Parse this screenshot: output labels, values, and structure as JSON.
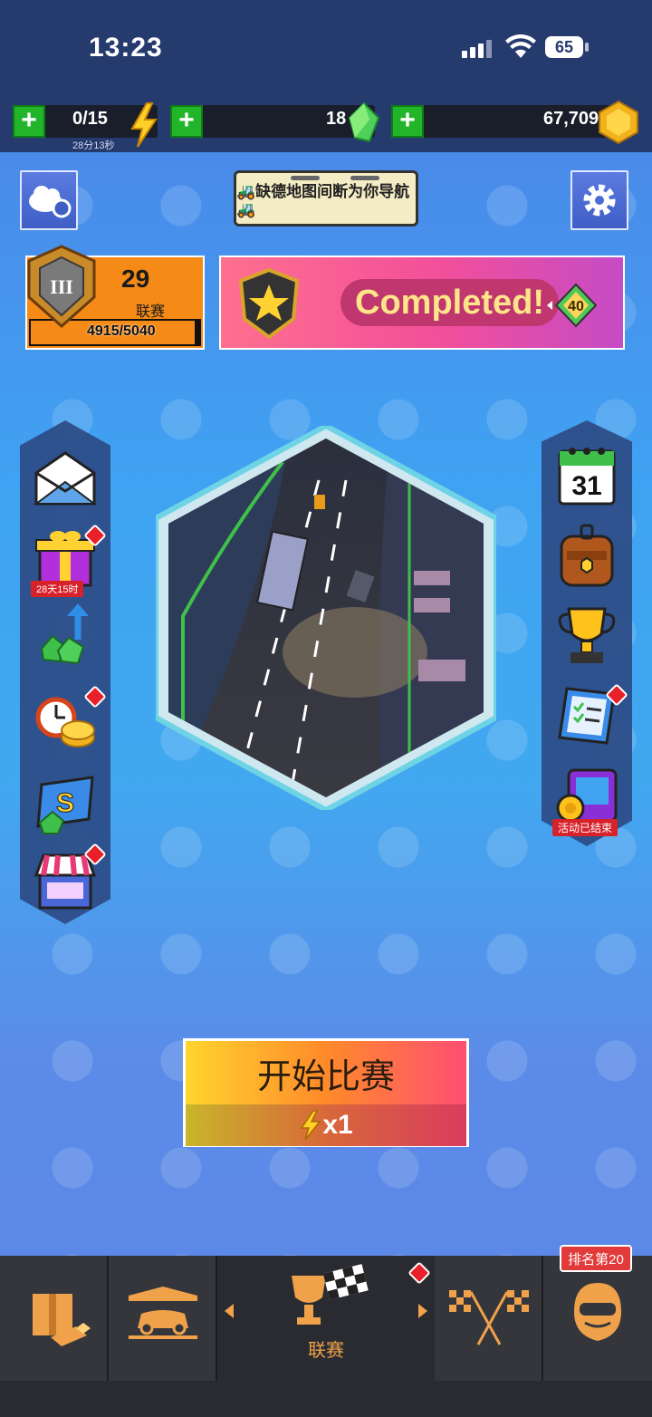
{
  "status_bar": {
    "time": "13:23",
    "battery": "65"
  },
  "resources": {
    "energy": {
      "value": "0/15",
      "timer": "28分13秒"
    },
    "gems": {
      "value": "18"
    },
    "coins": {
      "value": "67,709"
    }
  },
  "news_ticker": {
    "text": "🚜缺德地图间断为你导航🚜"
  },
  "league": {
    "rank_number": "29",
    "label": "联赛",
    "xp_text": "4915/5040",
    "xp_progress": 0.975,
    "tier": "III"
  },
  "promo": {
    "text": "Completed!",
    "reward": "40"
  },
  "left_menu": {
    "gift_timer": "28天15时"
  },
  "right_menu": {
    "calendar_day": "31",
    "event_tag": "活动已结束"
  },
  "start_button": {
    "label": "开始比赛",
    "cost": "x1"
  },
  "bottom_nav": {
    "league_label": "联赛",
    "rank_tag": "排名第20"
  },
  "colors": {
    "accent_orange": "#f58a16",
    "plus_green": "#22b52a",
    "nav_text": "#f0a24b"
  }
}
